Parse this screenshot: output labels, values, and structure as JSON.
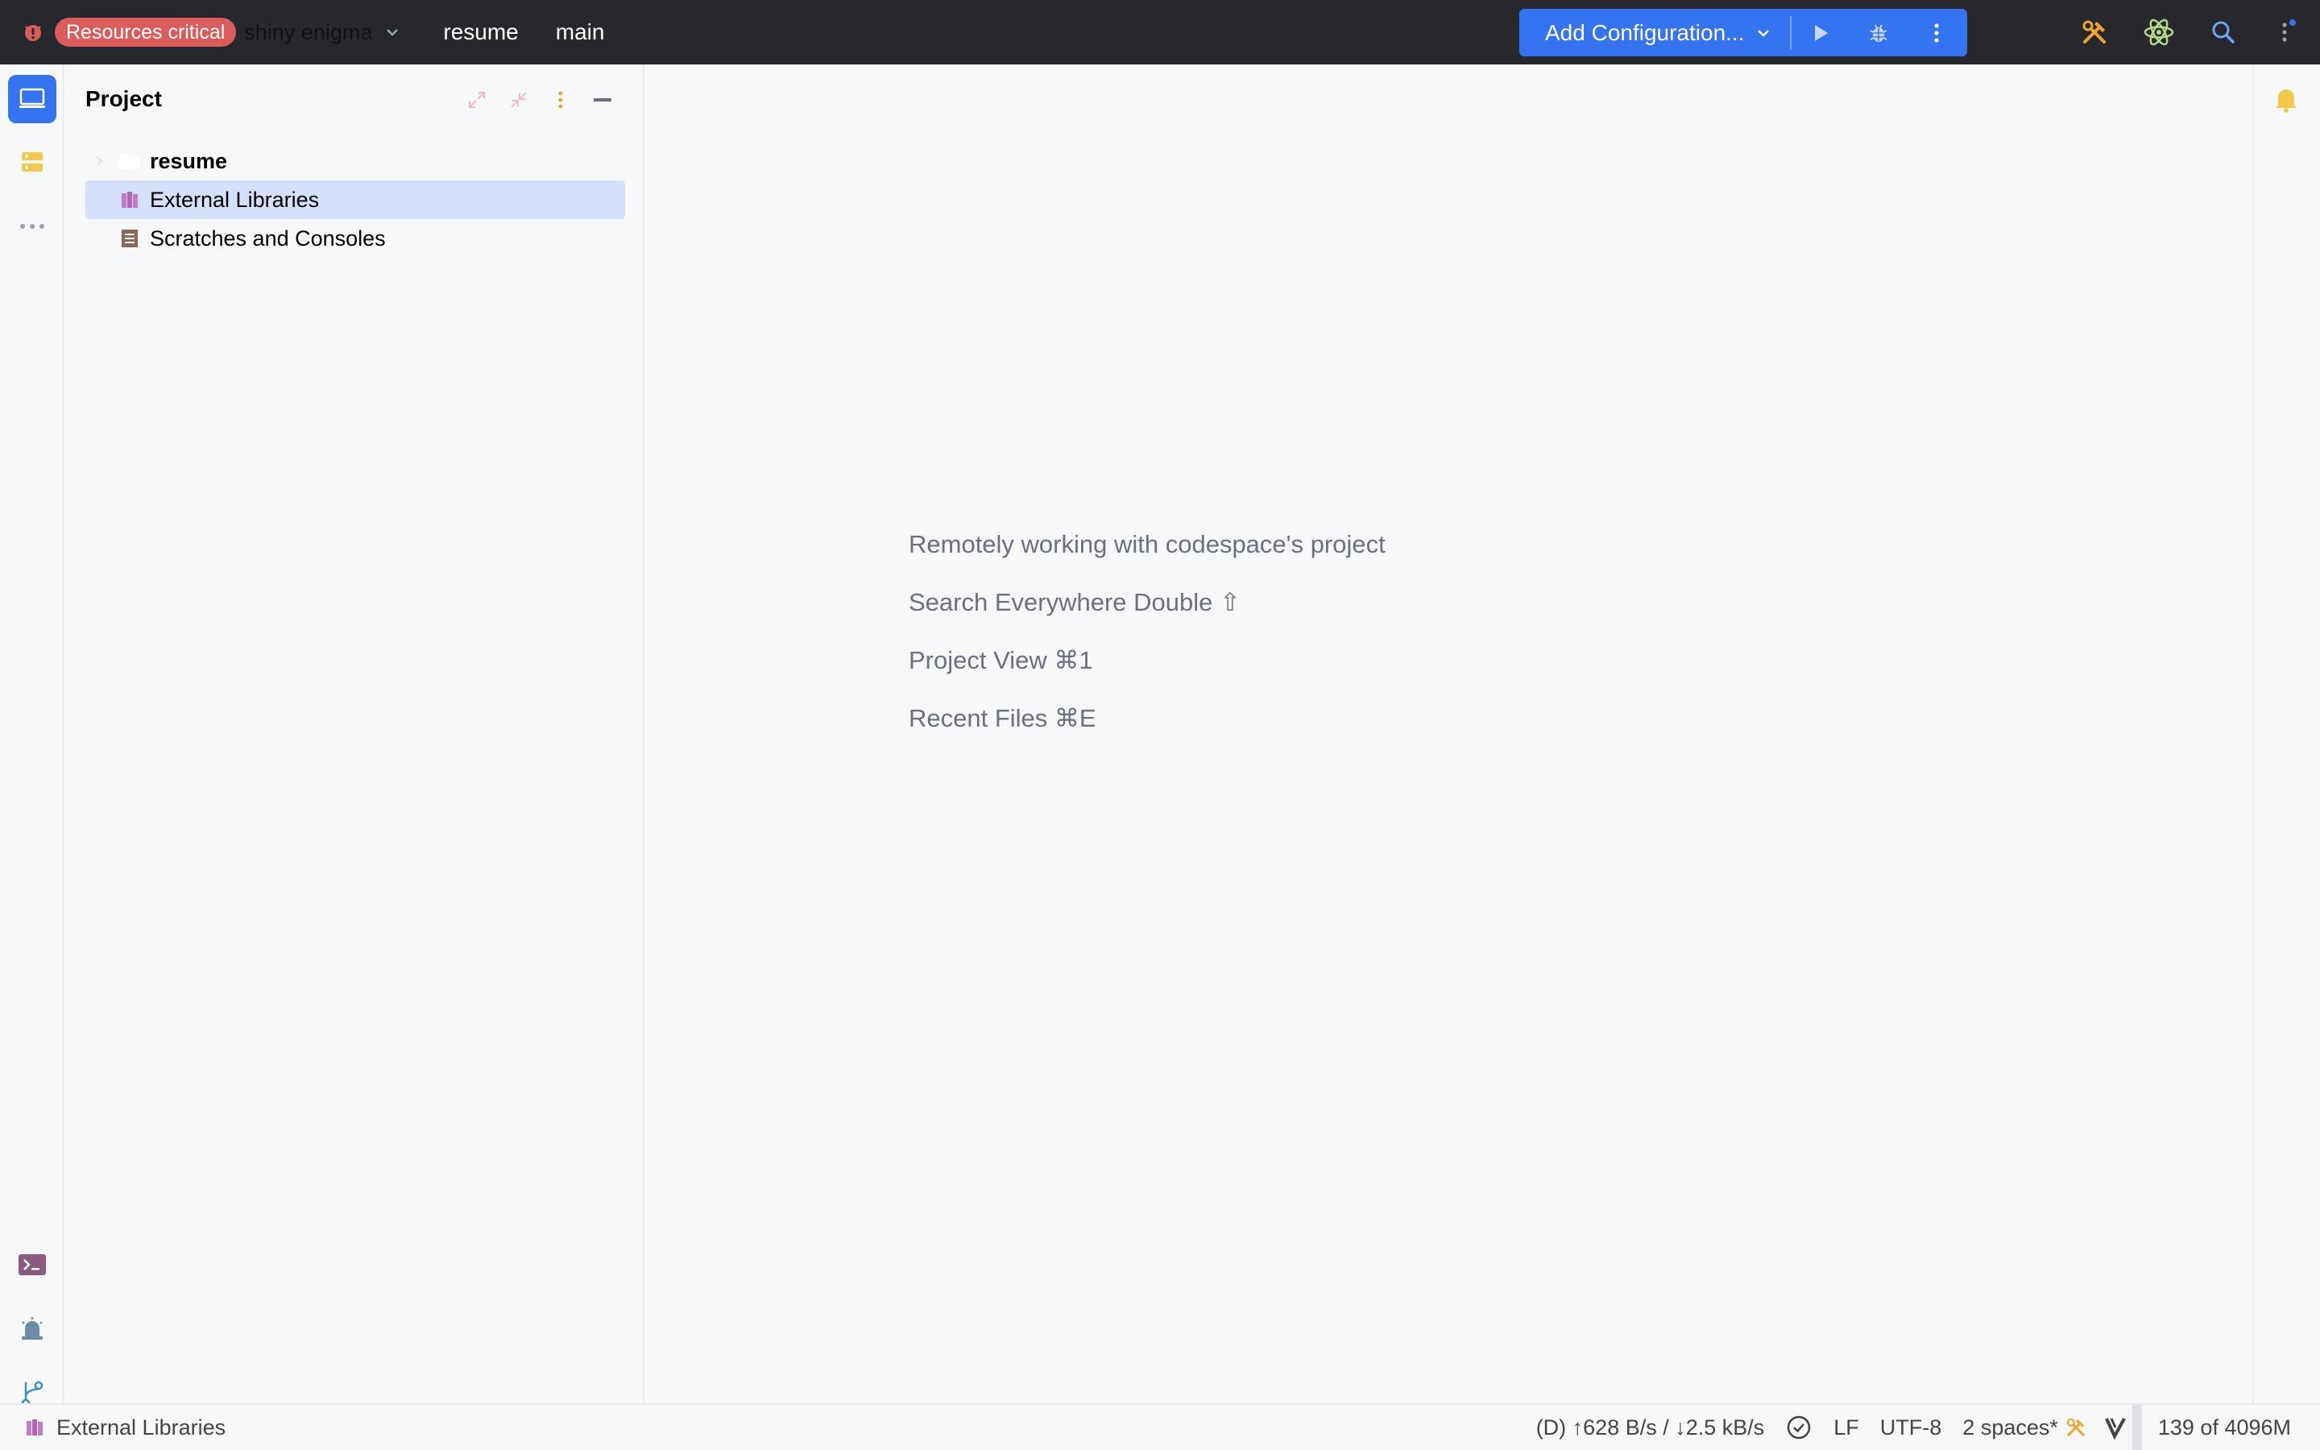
{
  "titlebar": {
    "resources_badge": "Resources critical",
    "project_name": "shiny enigma",
    "repo": "resume",
    "branch": "main",
    "run_config": "Add Configuration..."
  },
  "project_panel": {
    "title": "Project",
    "tree": [
      {
        "label": "resume",
        "icon": "folder-icon",
        "bold": true
      },
      {
        "label": "External Libraries",
        "icon": "library-icon",
        "selected": true
      },
      {
        "label": "Scratches and Consoles",
        "icon": "scratches-icon"
      }
    ]
  },
  "editor": {
    "hints": [
      "Remotely working with codespace's project",
      "Search Everywhere Double ⇧",
      "Project View ⌘1",
      "Recent Files ⌘E"
    ]
  },
  "statusbar": {
    "breadcrumb": "External Libraries",
    "network": "(D) ↑628 B/s / ↓2.5 kB/s",
    "line_separator": "LF",
    "encoding": "UTF-8",
    "indent": "2 spaces*",
    "memory": "139 of 4096M"
  },
  "colors": {
    "titlebar_bg": "#27282c",
    "badge_red": "#db5c5c",
    "accent_blue": "#3574f0",
    "selection": "#d5e1fb",
    "hint_text": "#6c707e"
  }
}
